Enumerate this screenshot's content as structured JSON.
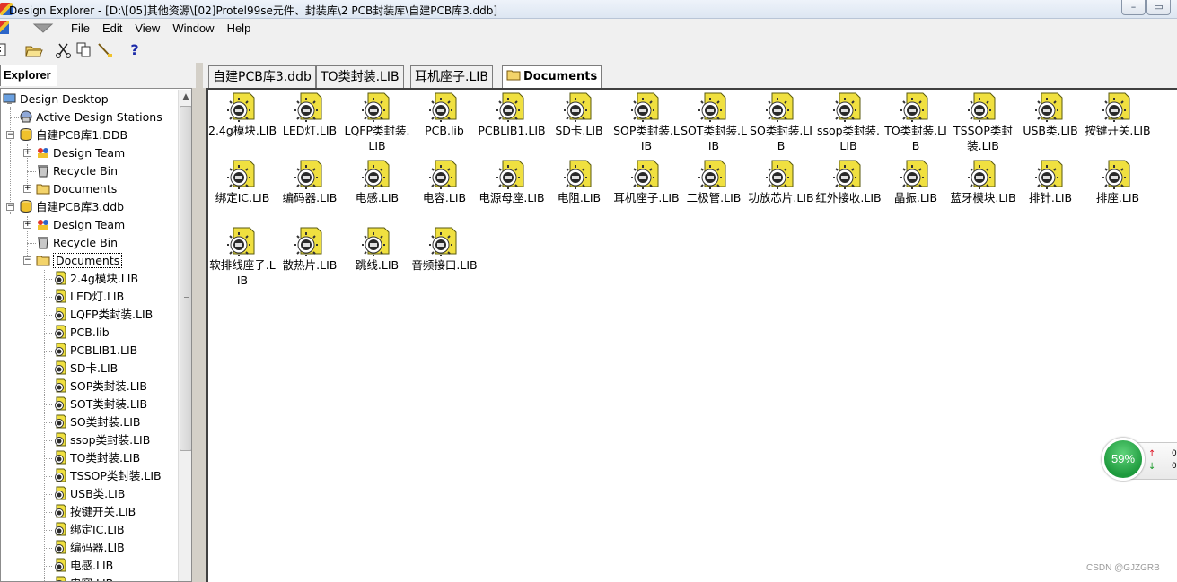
{
  "window": {
    "title": "Design Explorer - [D:\\[05]其他资源\\[02]Protel99se元件、封装库\\2 PCB封装库\\自建PCB库3.ddb]"
  },
  "menu": [
    "File",
    "Edit",
    "View",
    "Window",
    "Help"
  ],
  "toolbar": {
    "help_label": "?"
  },
  "explorer": {
    "tab_label": "Explorer",
    "nodes": {
      "desktop": "Design Desktop",
      "stations": "Active Design Stations",
      "db1": "自建PCB库1.DDB",
      "db1_team": "Design Team",
      "db1_bin": "Recycle Bin",
      "db1_docs": "Documents",
      "db3": "自建PCB库3.ddb",
      "db3_team": "Design Team",
      "db3_bin": "Recycle Bin",
      "db3_docs": "Documents"
    },
    "doc_files": [
      "2.4g模块.LIB",
      "LED灯.LIB",
      "LQFP类封装.LIB",
      "PCB.lib",
      "PCBLIB1.LIB",
      "SD卡.LIB",
      "SOP类封装.LIB",
      "SOT类封装.LIB",
      "SO类封装.LIB",
      "ssop类封装.LIB",
      "TO类封装.LIB",
      "TSSOP类封装.LIB",
      "USB类.LIB",
      "按键开关.LIB",
      "绑定IC.LIB",
      "编码器.LIB",
      "电感.LIB",
      "电容.LIB"
    ]
  },
  "tabs": [
    "自建PCB库3.ddb",
    "TO类封装.LIB",
    "耳机座子.LIB",
    "Documents"
  ],
  "files": [
    "2.4g模块.LIB",
    "LED灯.LIB",
    "LQFP类封装.LIB",
    "PCB.lib",
    "PCBLIB1.LIB",
    "SD卡.LIB",
    "SOP类封装.LIB",
    "SOT类封装.LIB",
    "SO类封装.LIB",
    "ssop类封装.LIB",
    "TO类封装.LIB",
    "TSSOP类封装.LIB",
    "USB类.LIB",
    "按键开关.LIB",
    "绑定IC.LIB",
    "编码器.LIB",
    "电感.LIB",
    "电容.LIB",
    "电源母座.LIB",
    "电阻.LIB",
    "耳机座子.LIB",
    "二极管.LIB",
    "功放芯片.LIB",
    "红外接收.LIB",
    "晶振.LIB",
    "蓝牙模块.LIB",
    "排针.LIB",
    "排座.LIB",
    "软排线座子.LIB",
    "散热片.LIB",
    "跳线.LIB",
    "音频接口.LIB"
  ],
  "net_widget": {
    "percent": "59%",
    "up_value": "0",
    "down_value": "0"
  },
  "watermark": "CSDN @GJZGRB",
  "colors": {
    "selection_border": "#000000",
    "app_bg": "#d4d0c8",
    "lib_icon_yellow": "#f0e040"
  }
}
